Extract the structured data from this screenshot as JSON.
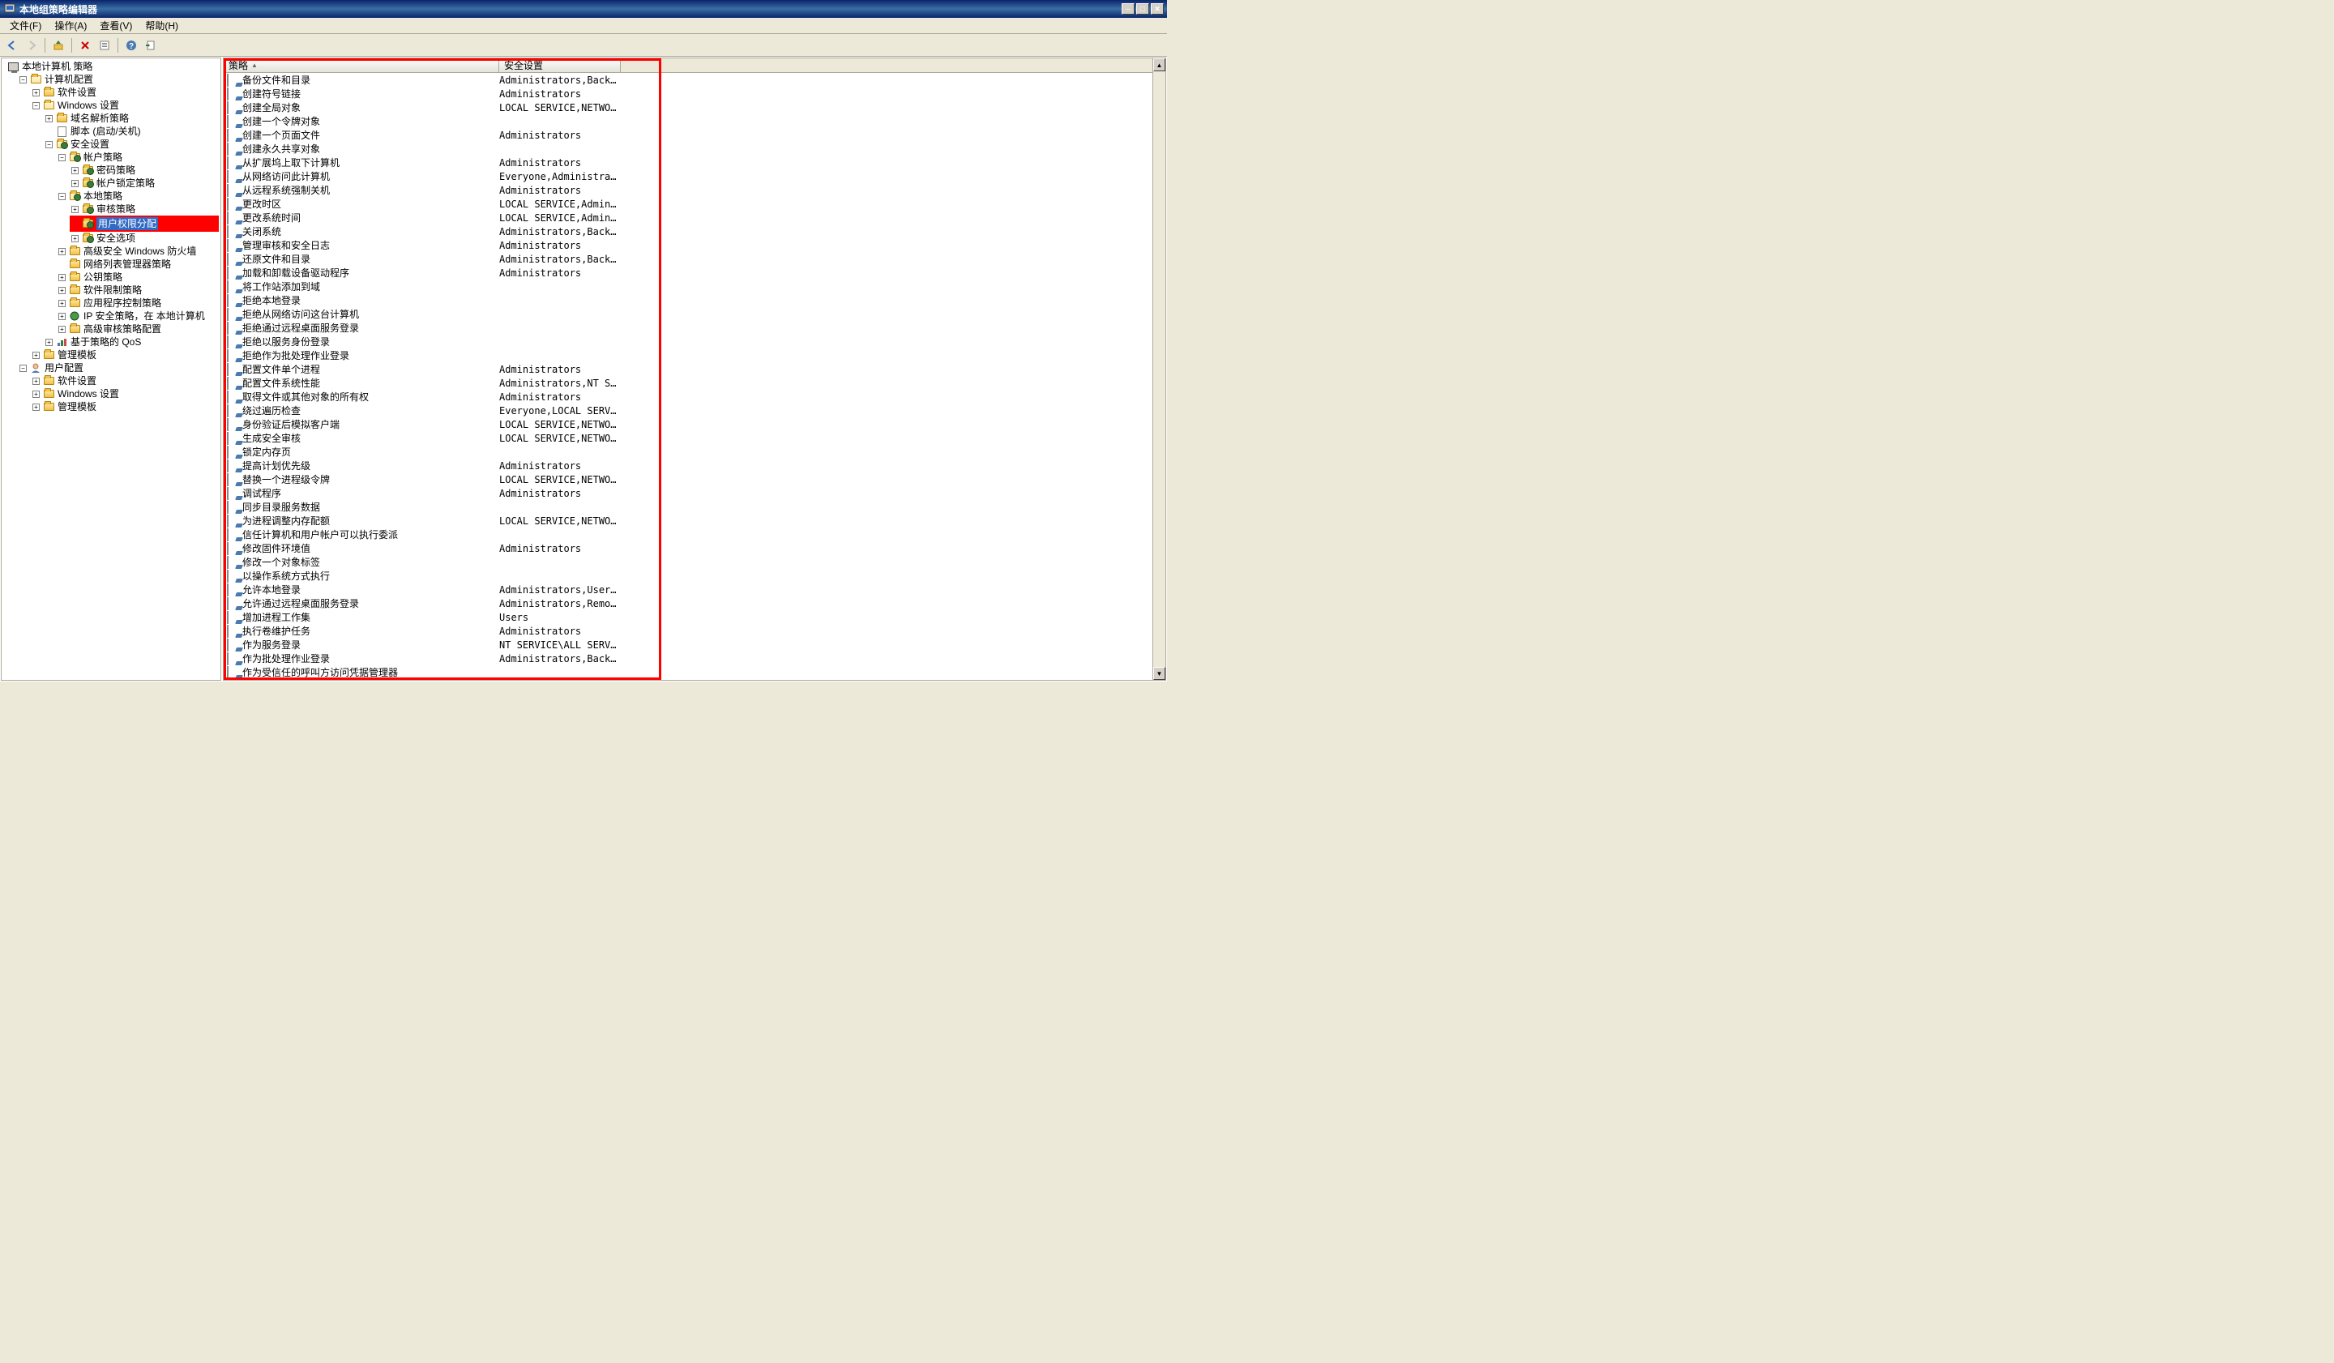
{
  "window": {
    "title": "本地组策略编辑器"
  },
  "menu": {
    "file": "文件(F)",
    "action": "操作(A)",
    "view": "查看(V)",
    "help": "帮助(H)"
  },
  "tree": {
    "root": "本地计算机 策略",
    "computer_config": "计算机配置",
    "software_settings": "软件设置",
    "windows_settings": "Windows 设置",
    "name_resolution": "域名解析策略",
    "scripts": "脚本 (启动/关机)",
    "security_settings": "安全设置",
    "account_policies": "帐户策略",
    "password_policy": "密码策略",
    "lockout_policy": "帐户锁定策略",
    "local_policies": "本地策略",
    "audit_policy": "审核策略",
    "user_rights": "用户权限分配",
    "security_options": "安全选项",
    "advanced_firewall": "高级安全 Windows 防火墙",
    "network_list": "网络列表管理器策略",
    "public_key": "公钥策略",
    "software_restriction": "软件限制策略",
    "app_control": "应用程序控制策略",
    "ip_security": "IP 安全策略，在 本地计算机",
    "advanced_audit": "高级审核策略配置",
    "policy_qos": "基于策略的 QoS",
    "admin_templates": "管理模板",
    "user_config": "用户配置",
    "software_settings2": "软件设置",
    "windows_settings2": "Windows 设置",
    "admin_templates2": "管理模板"
  },
  "columns": {
    "policy": "策略",
    "setting": "安全设置"
  },
  "policies": [
    {
      "name": "备份文件和目录",
      "setting": "Administrators,Backu..."
    },
    {
      "name": "创建符号链接",
      "setting": "Administrators"
    },
    {
      "name": "创建全局对象",
      "setting": "LOCAL SERVICE,NETWOR..."
    },
    {
      "name": "创建一个令牌对象",
      "setting": ""
    },
    {
      "name": "创建一个页面文件",
      "setting": "Administrators"
    },
    {
      "name": "创建永久共享对象",
      "setting": ""
    },
    {
      "name": "从扩展坞上取下计算机",
      "setting": "Administrators"
    },
    {
      "name": "从网络访问此计算机",
      "setting": "Everyone,Administrat..."
    },
    {
      "name": "从远程系统强制关机",
      "setting": "Administrators"
    },
    {
      "name": "更改时区",
      "setting": "LOCAL SERVICE,Admini..."
    },
    {
      "name": "更改系统时间",
      "setting": "LOCAL SERVICE,Admini..."
    },
    {
      "name": "关闭系统",
      "setting": "Administrators,Backu..."
    },
    {
      "name": "管理审核和安全日志",
      "setting": "Administrators"
    },
    {
      "name": "还原文件和目录",
      "setting": "Administrators,Backu..."
    },
    {
      "name": "加载和卸载设备驱动程序",
      "setting": "Administrators"
    },
    {
      "name": "将工作站添加到域",
      "setting": ""
    },
    {
      "name": "拒绝本地登录",
      "setting": ""
    },
    {
      "name": "拒绝从网络访问这台计算机",
      "setting": ""
    },
    {
      "name": "拒绝通过远程桌面服务登录",
      "setting": ""
    },
    {
      "name": "拒绝以服务身份登录",
      "setting": ""
    },
    {
      "name": "拒绝作为批处理作业登录",
      "setting": ""
    },
    {
      "name": "配置文件单个进程",
      "setting": "Administrators"
    },
    {
      "name": "配置文件系统性能",
      "setting": "Administrators,NT SE..."
    },
    {
      "name": "取得文件或其他对象的所有权",
      "setting": "Administrators"
    },
    {
      "name": "绕过遍历检查",
      "setting": "Everyone,LOCAL SERVI..."
    },
    {
      "name": "身份验证后模拟客户端",
      "setting": "LOCAL SERVICE,NETWOR..."
    },
    {
      "name": "生成安全审核",
      "setting": "LOCAL SERVICE,NETWOR..."
    },
    {
      "name": "锁定内存页",
      "setting": ""
    },
    {
      "name": "提高计划优先级",
      "setting": "Administrators"
    },
    {
      "name": "替换一个进程级令牌",
      "setting": "LOCAL SERVICE,NETWOR..."
    },
    {
      "name": "调试程序",
      "setting": "Administrators"
    },
    {
      "name": "同步目录服务数据",
      "setting": ""
    },
    {
      "name": "为进程调整内存配额",
      "setting": "LOCAL SERVICE,NETWOR..."
    },
    {
      "name": "信任计算机和用户帐户可以执行委派",
      "setting": ""
    },
    {
      "name": "修改固件环境值",
      "setting": "Administrators"
    },
    {
      "name": "修改一个对象标签",
      "setting": ""
    },
    {
      "name": "以操作系统方式执行",
      "setting": ""
    },
    {
      "name": "允许本地登录",
      "setting": "Administrators,Users..."
    },
    {
      "name": "允许通过远程桌面服务登录",
      "setting": "Administrators,Remot..."
    },
    {
      "name": "增加进程工作集",
      "setting": "Users"
    },
    {
      "name": "执行卷维护任务",
      "setting": "Administrators"
    },
    {
      "name": "作为服务登录",
      "setting": "NT SERVICE\\ALL SERVI..."
    },
    {
      "name": "作为批处理作业登录",
      "setting": "Administrators,Backu..."
    },
    {
      "name": "作为受信任的呼叫方访问凭据管理器",
      "setting": ""
    }
  ]
}
